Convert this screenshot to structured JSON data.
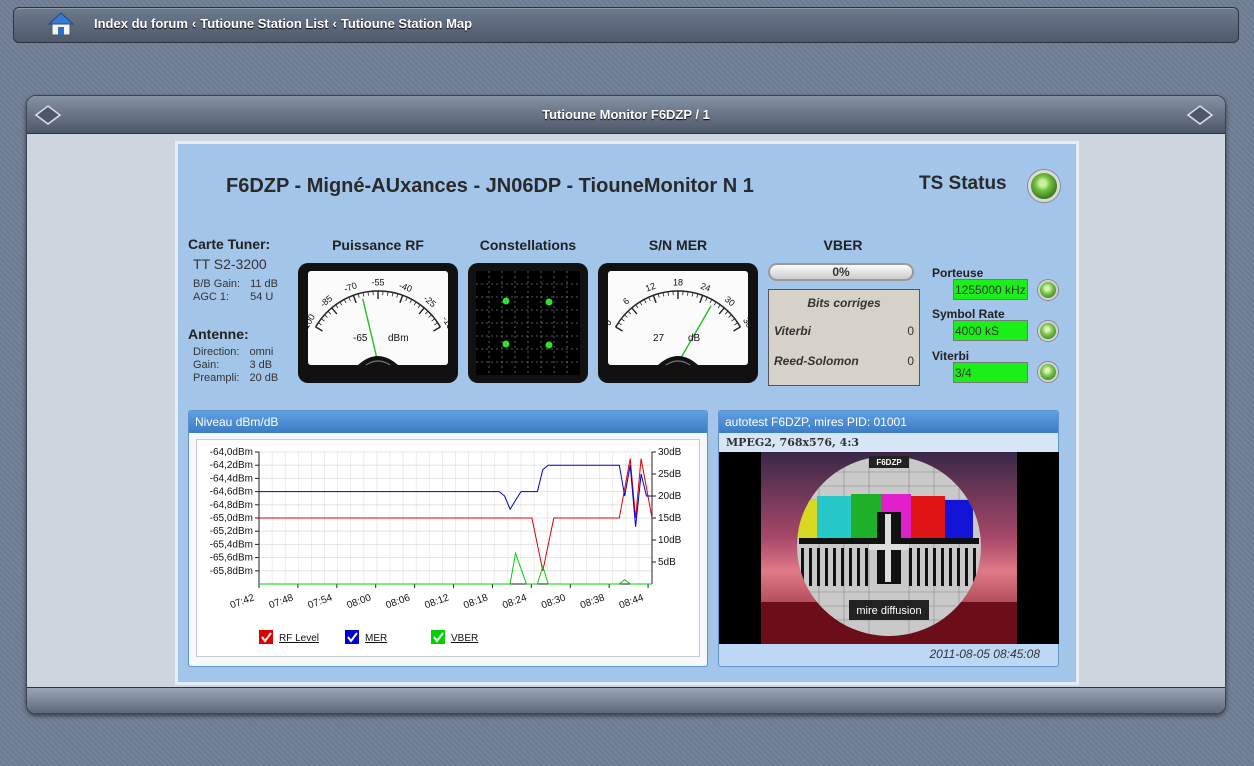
{
  "breadcrumb": {
    "items": [
      "Index du forum",
      "Tutioune Station List",
      "Tutioune Station Map"
    ],
    "separator": "‹"
  },
  "panel": {
    "title": "Tutioune Monitor F6DZP / 1"
  },
  "monitor": {
    "station_title": "F6DZP - Migné-AUxances - JN06DP - TiouneMonitor N 1",
    "ts_status_label": "TS Status",
    "tuner": {
      "heading": "Carte Tuner:",
      "card": "TT S2-3200",
      "rows": [
        [
          "B/B Gain:",
          "11 dB"
        ],
        [
          "AGC 1:",
          "54 U"
        ]
      ]
    },
    "antenna": {
      "heading": "Antenne:",
      "rows": [
        [
          "Direction:",
          "omni"
        ],
        [
          "Gain:",
          "3 dB"
        ],
        [
          "Preampli:",
          "20 dB"
        ]
      ]
    },
    "columns": {
      "rf": "Puissance RF",
      "const": "Constellations",
      "mer": "S/N MER",
      "vber": "VBER"
    },
    "rf_meter": {
      "ticks": [
        "-100",
        "-85",
        "-70",
        "-55",
        "-40",
        "-25",
        "-10"
      ],
      "value": "-65",
      "unit": "dBm"
    },
    "mer_meter": {
      "ticks": [
        "0",
        "6",
        "12",
        "18",
        "24",
        "30",
        "36"
      ],
      "value": "27",
      "unit": "dB"
    },
    "vber": {
      "percent": "0%",
      "title": "Bits corriges",
      "rows": [
        {
          "label": "Viterbi",
          "value": "0"
        },
        {
          "label": "Reed-Solomon",
          "value": "0"
        }
      ]
    },
    "signal": {
      "porteuse_label": "Porteuse",
      "porteuse_value": "1255000 kHz",
      "symbol_label": "Symbol Rate",
      "symbol_value": "4000 kS",
      "viterbi_label": "Viterbi",
      "viterbi_value": "3/4"
    },
    "graph": {
      "header": "Niveau dBm/dB",
      "legend": [
        {
          "label": "RF Level",
          "color": "#e00000"
        },
        {
          "label": "MER",
          "color": "#0000d0"
        },
        {
          "label": "VBER",
          "color": "#00d000"
        }
      ]
    },
    "video": {
      "header": "autotest F6DZP, mires PID: 01001",
      "format": "MPEG2, 768x576, 4:3",
      "timestamp": "2011-08-05 08:45:08",
      "banner_top": "F6DZP",
      "banner_bottom": "mire diffusion"
    }
  },
  "chart_data": {
    "type": "line",
    "title": "Niveau dBm/dB",
    "x": [
      "07:42",
      "07:48",
      "07:54",
      "08:00",
      "08:06",
      "08:12",
      "08:18",
      "08:24",
      "08:30",
      "08:38",
      "08:44"
    ],
    "y_left_ticks": [
      "-64,0dBm",
      "-64,2dBm",
      "-64,4dBm",
      "-64,6dBm",
      "-64,8dBm",
      "-65,0dBm",
      "-65,2dBm",
      "-65,4dBm",
      "-65,6dBm",
      "-65,8dBm"
    ],
    "y_right_ticks": [
      "30dB",
      "25dB",
      "20dB",
      "15dB",
      "10dB",
      "5dB"
    ],
    "ylim_left": [
      -66.0,
      -64.0
    ],
    "ylim_right": [
      0,
      30
    ],
    "series": [
      {
        "name": "RF Level",
        "axis": "left",
        "points": [
          [
            0,
            -65.0
          ],
          [
            48,
            -65.0
          ],
          [
            50,
            -65.0
          ],
          [
            52,
            -65.8
          ],
          [
            54,
            -65.0
          ],
          [
            66,
            -65.0
          ],
          [
            68,
            -64.1
          ],
          [
            69,
            -65.0
          ],
          [
            70,
            -64.1
          ],
          [
            72,
            -65.0
          ]
        ]
      },
      {
        "name": "MER",
        "axis": "right",
        "points": [
          [
            0,
            21
          ],
          [
            44,
            21
          ],
          [
            45,
            20
          ],
          [
            46,
            17
          ],
          [
            47,
            19
          ],
          [
            48,
            21
          ],
          [
            51,
            21
          ],
          [
            52,
            26
          ],
          [
            53,
            27
          ],
          [
            66,
            27
          ],
          [
            67,
            20
          ],
          [
            68,
            27
          ],
          [
            69,
            13
          ],
          [
            70,
            25
          ],
          [
            71,
            20
          ],
          [
            72,
            20
          ]
        ]
      },
      {
        "name": "VBER",
        "axis": "right",
        "points": [
          [
            0,
            0
          ],
          [
            46,
            0
          ],
          [
            47,
            7
          ],
          [
            49,
            0
          ],
          [
            51,
            0
          ],
          [
            52,
            4
          ],
          [
            53,
            0
          ],
          [
            66,
            0
          ],
          [
            67,
            1
          ],
          [
            68,
            0
          ],
          [
            72,
            0
          ]
        ]
      }
    ]
  }
}
